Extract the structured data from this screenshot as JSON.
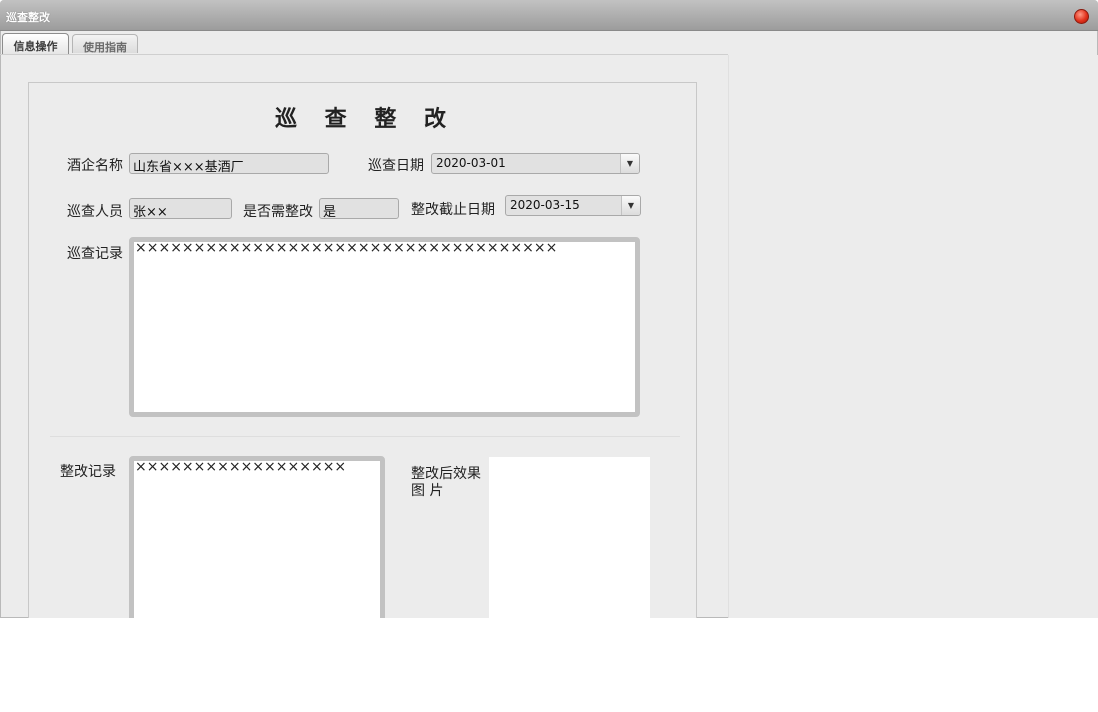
{
  "window": {
    "title": "巡查整改"
  },
  "tabs": [
    {
      "label": "信息操作",
      "active": true
    },
    {
      "label": "使用指南",
      "active": false
    }
  ],
  "form": {
    "heading": "巡 查 整 改",
    "enterprise": {
      "label": "酒企名称",
      "value": "山东省×××基酒厂"
    },
    "inspect_date": {
      "label": "巡查日期",
      "value": "2020-03-01"
    },
    "inspector": {
      "label": "巡查人员",
      "value": "张××"
    },
    "need_rectify": {
      "label": "是否需整改",
      "value": "是"
    },
    "deadline": {
      "label": "整改截止日期",
      "value": "2020-03-15"
    },
    "inspect_record": {
      "label": "巡查记录",
      "value": "××××××××××××××××××××××××××××××××××××"
    },
    "rectify_record": {
      "label": "整改记录",
      "value": "××××××××××××××××××"
    },
    "effect_image": {
      "label_line1": "整改后效果",
      "label_line2": "图 片"
    }
  },
  "colors": {
    "close_button": "#e2321c",
    "background": "#ececec"
  },
  "icons": {
    "close": "close-icon",
    "dropdown": "chevron-down-icon"
  }
}
